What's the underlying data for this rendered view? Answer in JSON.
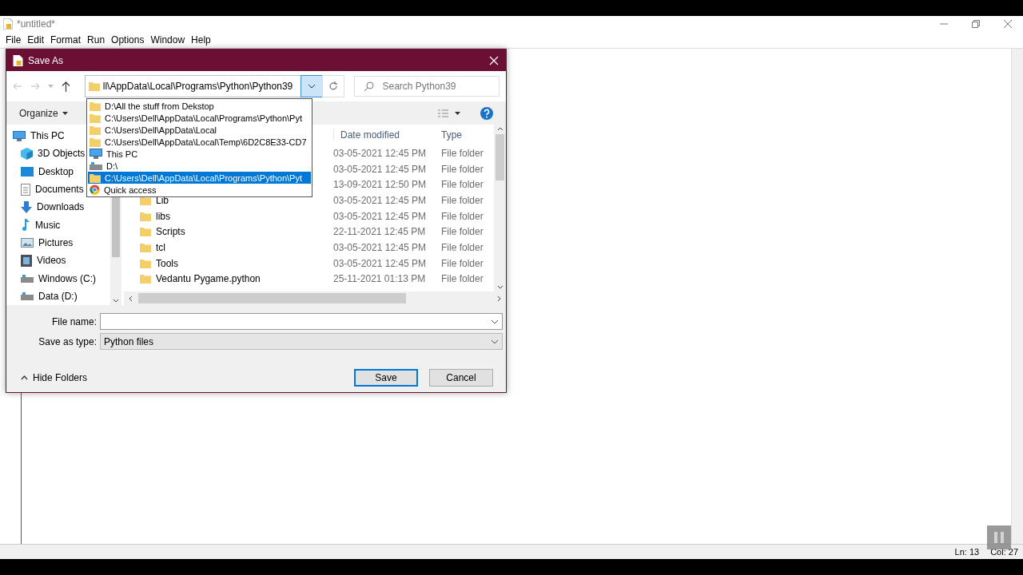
{
  "editor": {
    "title": "*untitled*",
    "menu": [
      "File",
      "Edit",
      "Format",
      "Run",
      "Options",
      "Window",
      "Help"
    ],
    "status": {
      "line": "Ln: 13",
      "column": "Col: 27"
    }
  },
  "dialog": {
    "title": "Save As",
    "address": "ll\\AppData\\Local\\Programs\\Python\\Python39",
    "search": {
      "placeholder": "Search Python39"
    },
    "organize": "Organize",
    "sidebar": [
      {
        "label": "This PC",
        "kind": "pc",
        "children": [
          {
            "label": "3D Objects",
            "kind": "cube"
          },
          {
            "label": "Desktop",
            "kind": "desktop"
          },
          {
            "label": "Documents",
            "kind": "document"
          },
          {
            "label": "Downloads",
            "kind": "download"
          },
          {
            "label": "Music",
            "kind": "music"
          },
          {
            "label": "Pictures",
            "kind": "pictures"
          },
          {
            "label": "Videos",
            "kind": "video"
          },
          {
            "label": "Windows (C:)",
            "kind": "drive"
          },
          {
            "label": "Data (D:)",
            "kind": "drive"
          }
        ]
      }
    ],
    "columns": [
      "Date modified",
      "Type"
    ],
    "rows": [
      {
        "date": "03-05-2021 12:45 PM",
        "type": "File folder"
      },
      {
        "date": "03-05-2021 12:45 PM",
        "type": "File folder"
      },
      {
        "date": "13-09-2021 12:50 PM",
        "type": "File folder"
      },
      {
        "name": "Lib",
        "date": "03-05-2021 12:45 PM",
        "type": "File folder"
      },
      {
        "name": "libs",
        "date": "03-05-2021 12:45 PM",
        "type": "File folder"
      },
      {
        "name": "Scripts",
        "date": "22-11-2021 12:45 PM",
        "type": "File folder"
      },
      {
        "name": "tcl",
        "date": "03-05-2021 12:45 PM",
        "type": "File folder"
      },
      {
        "name": "Tools",
        "date": "03-05-2021 12:45 PM",
        "type": "File folder"
      },
      {
        "name": "Vedantu Pygame.python",
        "date": "25-11-2021 01:13 PM",
        "type": "File folder"
      }
    ],
    "address_history": [
      {
        "label": "D:\\All the stuff from Dekstop",
        "kind": "folder",
        "selected": false
      },
      {
        "label": "C:\\Users\\Dell\\AppData\\Local\\Programs\\Python\\Pyt",
        "kind": "folder",
        "selected": false
      },
      {
        "label": "C:\\Users\\Dell\\AppData\\Local",
        "kind": "folder",
        "selected": false
      },
      {
        "label": "C:\\Users\\Dell\\AppData\\Local\\Temp\\6D2C8E33-CD7",
        "kind": "folder",
        "selected": false
      },
      {
        "label": "This PC",
        "kind": "pc",
        "selected": false
      },
      {
        "label": "D:\\",
        "kind": "drive",
        "selected": false
      },
      {
        "label": "C:\\Users\\Dell\\AppData\\Local\\Programs\\Python\\Pyt",
        "kind": "folder",
        "selected": true
      },
      {
        "label": "Quick access",
        "kind": "ring",
        "selected": false
      }
    ],
    "file_name": {
      "label": "File name:"
    },
    "save_as_type": {
      "label": "Save as type:",
      "value": "Python files"
    },
    "hide_folders": "Hide Folders",
    "buttons": [
      {
        "label": "Save",
        "default": true
      },
      {
        "label": "Cancel",
        "default": false
      }
    ]
  }
}
